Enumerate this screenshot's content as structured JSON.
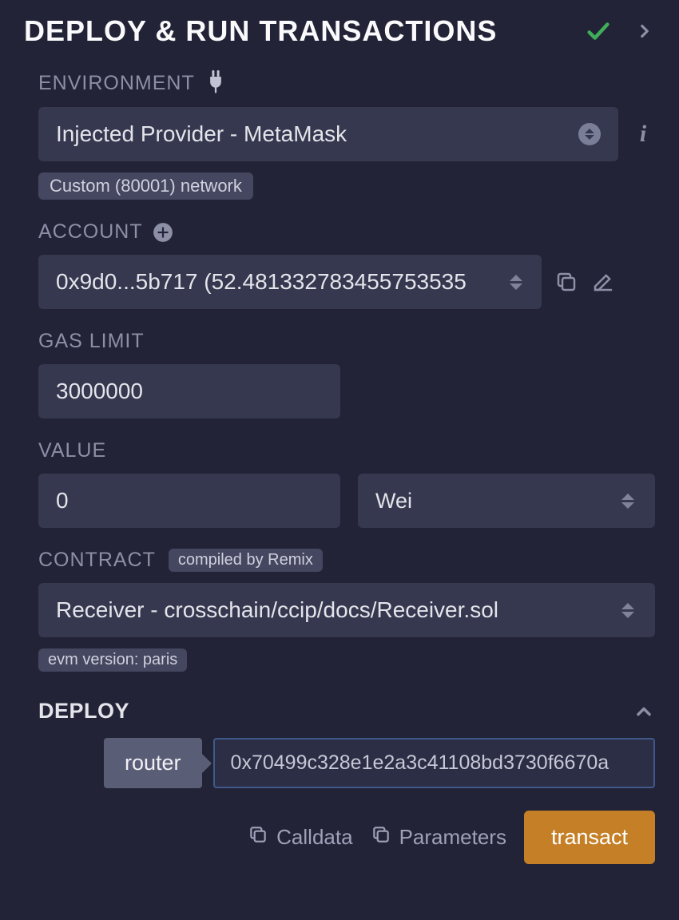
{
  "header": {
    "title": "DEPLOY & RUN TRANSACTIONS"
  },
  "environment": {
    "label": "ENVIRONMENT",
    "value": "Injected Provider - MetaMask",
    "network_badge": "Custom (80001) network"
  },
  "account": {
    "label": "ACCOUNT",
    "value": "0x9d0...5b717 (52.481332783455753535"
  },
  "gas": {
    "label": "GAS LIMIT",
    "value": "3000000"
  },
  "value": {
    "label": "VALUE",
    "amount": "0",
    "unit": "Wei"
  },
  "contract": {
    "label": "CONTRACT",
    "compiled_badge": "compiled by Remix",
    "value": "Receiver - crosschain/ccip/docs/Receiver.sol",
    "evm_badge": "evm version: paris"
  },
  "deploy": {
    "title": "DEPLOY",
    "params": [
      {
        "name": "router",
        "value": "0x70499c328e1e2a3c41108bd3730f6670a"
      }
    ],
    "actions": {
      "calldata": "Calldata",
      "parameters": "Parameters",
      "transact": "transact"
    }
  }
}
